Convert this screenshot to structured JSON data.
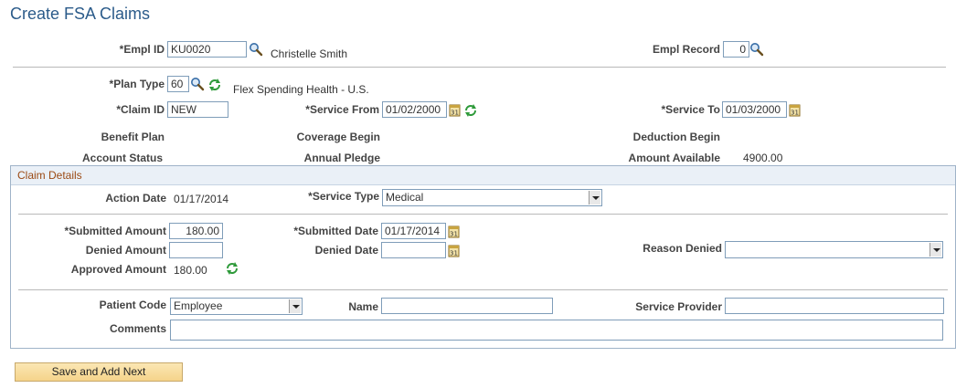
{
  "page": {
    "title": "Create FSA Claims"
  },
  "header": {
    "empl_id_label": "*Empl ID",
    "empl_id_value": "KU0020",
    "employee_name": "Christelle Smith",
    "empl_record_label": "Empl Record",
    "empl_record_value": "0"
  },
  "plan": {
    "plan_type_label": "*Plan Type",
    "plan_type_value": "60",
    "plan_description": "Flex Spending Health - U.S.",
    "claim_id_label": "*Claim ID",
    "claim_id_value": "NEW",
    "service_from_label": "*Service From",
    "service_from_value": "01/02/2000",
    "service_to_label": "*Service To",
    "service_to_value": "01/03/2000",
    "benefit_plan_label": "Benefit Plan",
    "coverage_begin_label": "Coverage Begin",
    "deduction_begin_label": "Deduction Begin",
    "account_status_label": "Account Status",
    "annual_pledge_label": "Annual Pledge",
    "amount_available_label": "Amount Available",
    "amount_available_value": "4900.00"
  },
  "claim_details": {
    "header": "Claim Details",
    "action_date_label": "Action Date",
    "action_date_value": "01/17/2014",
    "service_type_label": "*Service Type",
    "service_type_value": "Medical",
    "submitted_amount_label": "*Submitted Amount",
    "submitted_amount_value": "180.00",
    "submitted_date_label": "*Submitted Date",
    "submitted_date_value": "01/17/2014",
    "denied_amount_label": "Denied Amount",
    "denied_amount_value": "",
    "denied_date_label": "Denied Date",
    "denied_date_value": "",
    "reason_denied_label": "Reason Denied",
    "reason_denied_value": "",
    "approved_amount_label": "Approved Amount",
    "approved_amount_value": "180.00",
    "patient_code_label": "Patient Code",
    "patient_code_value": "Employee",
    "name_label": "Name",
    "name_value": "",
    "service_provider_label": "Service Provider",
    "service_provider_value": "",
    "comments_label": "Comments",
    "comments_value": ""
  },
  "actions": {
    "save_add_next_label": "Save and Add Next"
  },
  "icons": {
    "lookup": "magnifier-icon",
    "refresh": "refresh-icon",
    "calendar": "calendar-icon"
  },
  "colors": {
    "title": "#2b5b8a",
    "group_header_text": "#9b4a14",
    "button": "#f5d48a"
  }
}
